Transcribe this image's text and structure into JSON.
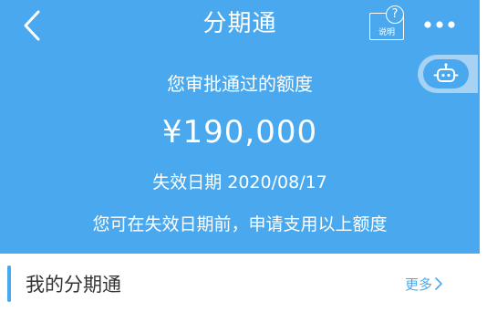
{
  "header": {
    "title": "分期通",
    "help_label": "说明",
    "help_glyph": "?",
    "back_icon": "chevron-left-icon",
    "more_icon": "more-dots-icon"
  },
  "hero": {
    "approved_label": "您审批通过的额度",
    "amount": "¥190,000",
    "expire_text": "失效日期 2020/08/17",
    "note": "您可在失效日期前，申请支用以上额度",
    "robot_icon": "robot-assistant-icon"
  },
  "section": {
    "title": "我的分期通",
    "more_label": "更多"
  },
  "colors": {
    "primary": "#4aa9ee",
    "robot_bubble": "#a8d2f4",
    "text_dark": "#333333",
    "white": "#ffffff"
  }
}
